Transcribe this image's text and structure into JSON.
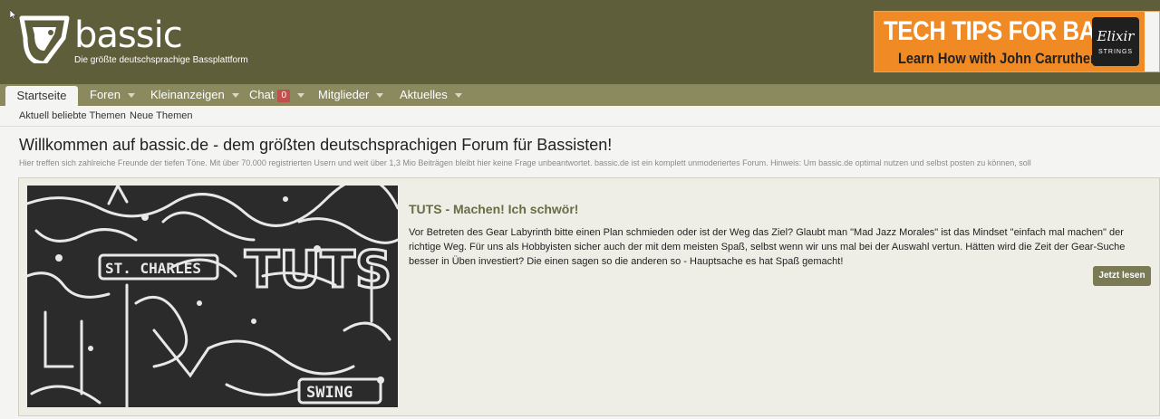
{
  "header": {
    "logo_word": "bassic",
    "logo_tagline": "Die größte deutschsprachige Bassplattform",
    "ad": {
      "line1": "TECH TIPS FOR BASS",
      "line2": "Learn How with John Carruthers",
      "badge_text": "Elixir",
      "badge_sub": "STRINGS"
    }
  },
  "nav": {
    "items": [
      {
        "label": "Startseite"
      },
      {
        "label": "Foren"
      },
      {
        "label": "Kleinanzeigen"
      },
      {
        "label": "Chat",
        "badge": "0"
      },
      {
        "label": "Mitglieder"
      },
      {
        "label": "Aktuelles"
      }
    ],
    "sub_items": [
      {
        "label": "Aktuell beliebte Themen"
      },
      {
        "label": "Neue Themen"
      }
    ]
  },
  "main": {
    "title": "Willkommen auf bassic.de - dem größten deutschsprachigen Forum für Bassisten!",
    "intro": "Hier treffen sich zahlreiche Freunde der tiefen Töne. Mit über 70.000 registrierten Usern und weit über 1,3 Mio Beiträgen bleibt hier keine Frage unbeantwortet. bassic.de ist ein komplett unmoderiertes Forum. Hinweis: Um bassic.de optimal nutzen und selbst posten zu können, soll",
    "feature": {
      "title": "TUTS - Machen! Ich schwör!",
      "body": "Vor Betreten des Gear Labyrinth bitte einen Plan schmieden oder ist der Weg das Ziel? Glaubt man \"Mad Jazz Morales\" ist das Mindset \"einfach mal machen\" der richtige Weg. Für uns als Hobbyisten sicher auch der mit dem meisten Spaß, selbst wenn wir uns mal bei der Auswahl vertun. Hätten wird die Zeit der Gear-Suche besser in Üben investiert? Die einen sagen so die anderen so - Hauptsache es hat Spaß gemacht!",
      "button": "Jetzt lesen",
      "art_labels": [
        "ST. CHARLES",
        "TUTS",
        "SWING"
      ]
    }
  },
  "colors": {
    "header_bg": "#5f5e3b",
    "nav_bg": "#8a8a5e",
    "accent": "#6b6b44",
    "ad_orange": "#f08a24",
    "badge_red": "#c0504d"
  }
}
